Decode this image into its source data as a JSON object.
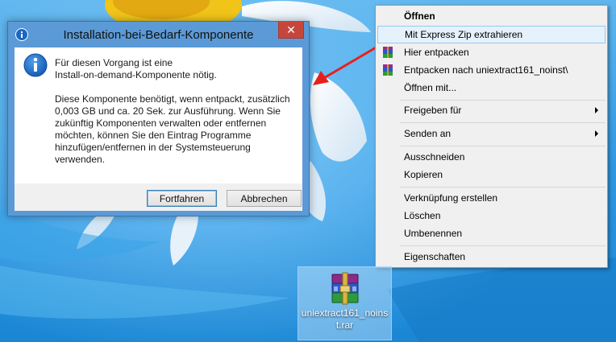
{
  "dialog": {
    "title": "Installation-bei-Bedarf-Komponente",
    "close_glyph": "✕",
    "message_line1": "Für diesen Vorgang ist eine\nInstall-on-demand-Komponente nötig.",
    "message_line2": "Diese Komponente benötigt, wenn entpackt, zusätzlich\n0,003 GB und ca. 20 Sek. zur Ausführung. Wenn Sie\nzukünftig Komponenten verwalten oder entfernen\nmöchten, können Sie den Eintrag Programme\nhinzufügen/entfernen in der Systemsteuerung\nverwenden.",
    "continue_label": "Fortfahren",
    "cancel_label": "Abbrechen",
    "info_icon": "info-icon"
  },
  "context_menu": {
    "items": [
      {
        "label": "Öffnen",
        "bold": true
      },
      {
        "label": "Mit Express Zip extrahieren",
        "highlighted": true
      },
      {
        "label": "Hier entpacken",
        "icon": "winrar-icon"
      },
      {
        "label": "Entpacken nach uniextract161_noinst\\",
        "icon": "winrar-icon"
      },
      {
        "label": "Öffnen mit..."
      },
      {
        "label": "Freigeben für",
        "submenu": true
      },
      {
        "label": "Senden an",
        "submenu": true
      },
      {
        "label": "Ausschneiden"
      },
      {
        "label": "Kopieren"
      },
      {
        "label": "Verknüpfung erstellen"
      },
      {
        "label": "Löschen"
      },
      {
        "label": "Umbenennen"
      },
      {
        "label": "Eigenschaften"
      }
    ]
  },
  "desktop_icon": {
    "label": "uniextract161_noinst.rar",
    "icon": "winrar-archive-icon"
  },
  "colors": {
    "annotation_arrow": "#e8201c",
    "dialog_frame": "#5b9ad6",
    "close_button": "#c7463c",
    "menu_highlight": "#e5f1fb"
  }
}
